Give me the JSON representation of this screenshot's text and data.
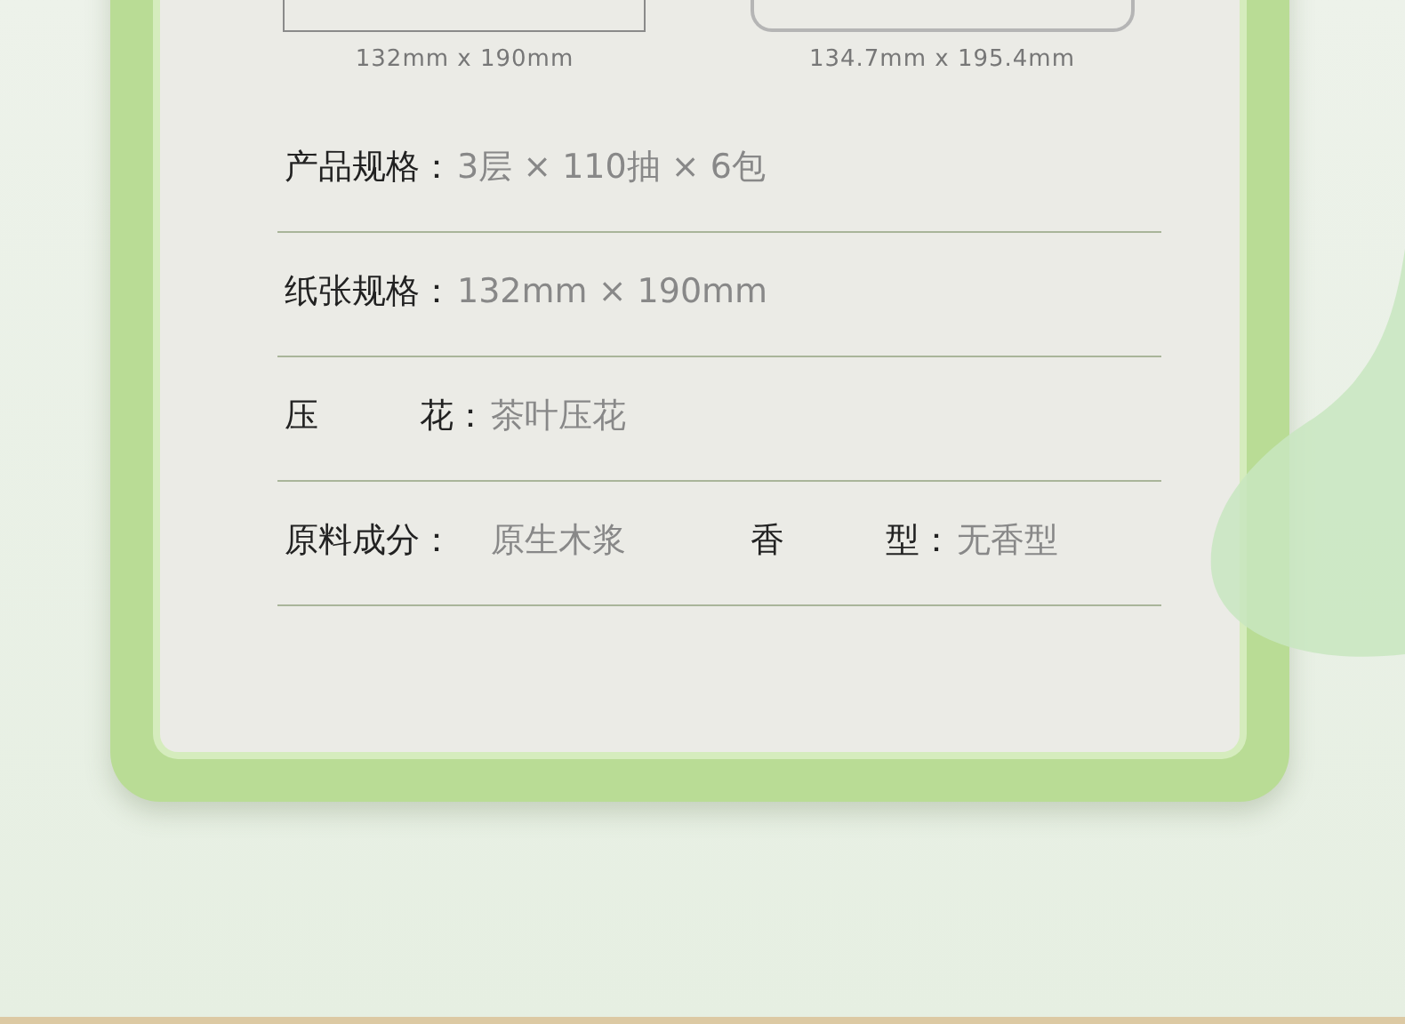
{
  "sizes": [
    "132mm x 190mm",
    "134.7mm x 195.4mm"
  ],
  "rows": [
    {
      "items": [
        {
          "label": [
            "产品规格："
          ],
          "value": "3层 × 110抽 × 6包"
        }
      ]
    },
    {
      "items": [
        {
          "label": [
            "纸张规格："
          ],
          "value": "132mm × 190mm"
        }
      ]
    },
    {
      "items": [
        {
          "label": [
            "压",
            "花："
          ],
          "value": "茶叶压花"
        }
      ]
    },
    {
      "items": [
        {
          "label": [
            "原料成分："
          ],
          "value": "原生木浆"
        },
        {
          "label": [
            "香",
            "型："
          ],
          "value": "无香型"
        }
      ]
    }
  ]
}
